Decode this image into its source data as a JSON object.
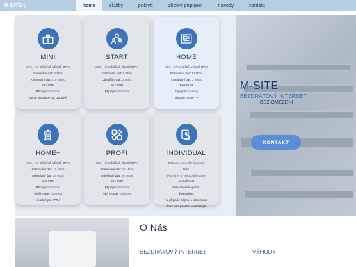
{
  "header": {
    "logo": "M-SITE",
    "logo_chevron": "▽",
    "nav": [
      "home",
      "služby",
      "pokrytí",
      "zřízení připojení",
      "návody",
      "kontakt"
    ]
  },
  "brand": {
    "title": "M-SITE",
    "line1": "BEZDRÁTOVÝ INTERNET",
    "line2": "BEZ OMEZENÍ",
    "contact_button": "KONTAKT"
  },
  "plans": [
    {
      "name": "MINI",
      "icon": "gift-icon",
      "lines": [
        {
          "hl": "170,- Kč",
          "text": " měsíčně včetně DPH"
        },
        {
          "text": "Stahování dat: ",
          "hl": "5 Mb/s"
        },
        {
          "text": "Odesílání dat: ",
          "hl": "0,5 Mb/s"
        },
        {
          "text": "Bez FUP"
        },
        {
          "text": "Připojení ",
          "hl": "zdarma"
        },
        {
          "text": "Cena instalace od: 1300Kč"
        }
      ]
    },
    {
      "name": "START",
      "icon": "users-icon",
      "lines": [
        {
          "hl": "260,- Kč",
          "text": " měsíčně včetně DPH"
        },
        {
          "text": "Stahování dat: ",
          "hl": "6 Mb/s"
        },
        {
          "text": "Odesílání dat: ",
          "hl": "1 Mb/s"
        },
        {
          "text": "Bez FUP"
        },
        {
          "text": "Připojení ",
          "hl": "zdarma"
        }
      ]
    },
    {
      "name": "HOME",
      "icon": "newspaper-icon",
      "lines": [
        {
          "hl": "330,- Kč",
          "text": " měsíčně včetně DPH"
        },
        {
          "text": "Stahování dat: ",
          "hl": "12 Mb/s"
        },
        {
          "text": "Odesílání dat: ",
          "hl": "2 Mb/s"
        },
        {
          "text": "Bez FUP"
        },
        {
          "text": "Připojení ",
          "hl": "zdarma"
        },
        {
          "text": "vhodné pro IPTV"
        }
      ]
    },
    {
      "name": "HOME+",
      "icon": "award-icon",
      "lines": [
        {
          "hl": "410,- Kč",
          "text": " měsíčně včetně DPH"
        },
        {
          "text": "Stahování dat: ",
          "hl": "15 Mb/s"
        },
        {
          "text": "Odesílání dat: ",
          "hl": "25 Mb/s"
        },
        {
          "text": "Bez FUP"
        },
        {
          "text": "Připojení ",
          "hl": "zdarma"
        },
        {
          "text": "Wifi Router ",
          "hl": "Zdarma"
        },
        {
          "text": "vhodné pro IPTV"
        }
      ]
    },
    {
      "name": "PROFI",
      "icon": "shapes-icon",
      "lines": [
        {
          "hl": "495,- Kč",
          "text": " měsíčně včetně DPH"
        },
        {
          "text": "Stahování dat: ",
          "hl": "60 Mb/s"
        },
        {
          "text": "Odesílání dat: ",
          "hl": "60 Mb/s"
        },
        {
          "text": "Bez FUP"
        },
        {
          "text": "Připojení ",
          "hl": "zdarma"
        },
        {
          "text": "Wifi Router ",
          "hl": "Zdarma"
        }
      ]
    },
    {
      "name": "INDIVIDUAL",
      "icon": "touch-icon",
      "lines": [
        {
          "text": "Smluvní ",
          "hl": "cena dle kapacity"
        },
        {
          "text": "linky."
        },
        {
          "hl": "Pro firmy a velkoodběratele"
        },
        {
          "text": "je možnost"
        },
        {
          "text": "dohodnout kapacitu"
        },
        {
          "text": "dlepotřeby."
        },
        {
          "text": "V případě zájmu o takovouto"
        },
        {
          "text": "linku nás prosím kontaktujte"
        }
      ]
    }
  ],
  "about": {
    "title": "O Nás",
    "sub1": "BEZDRÁTOVÝ INTERNET",
    "sub2": "VÝHODY"
  },
  "colors": {
    "accent": "#3d73b7",
    "highlight": "#3f6fa8",
    "nav_bg": "#b7cde3",
    "button": "#5b8ed4"
  }
}
